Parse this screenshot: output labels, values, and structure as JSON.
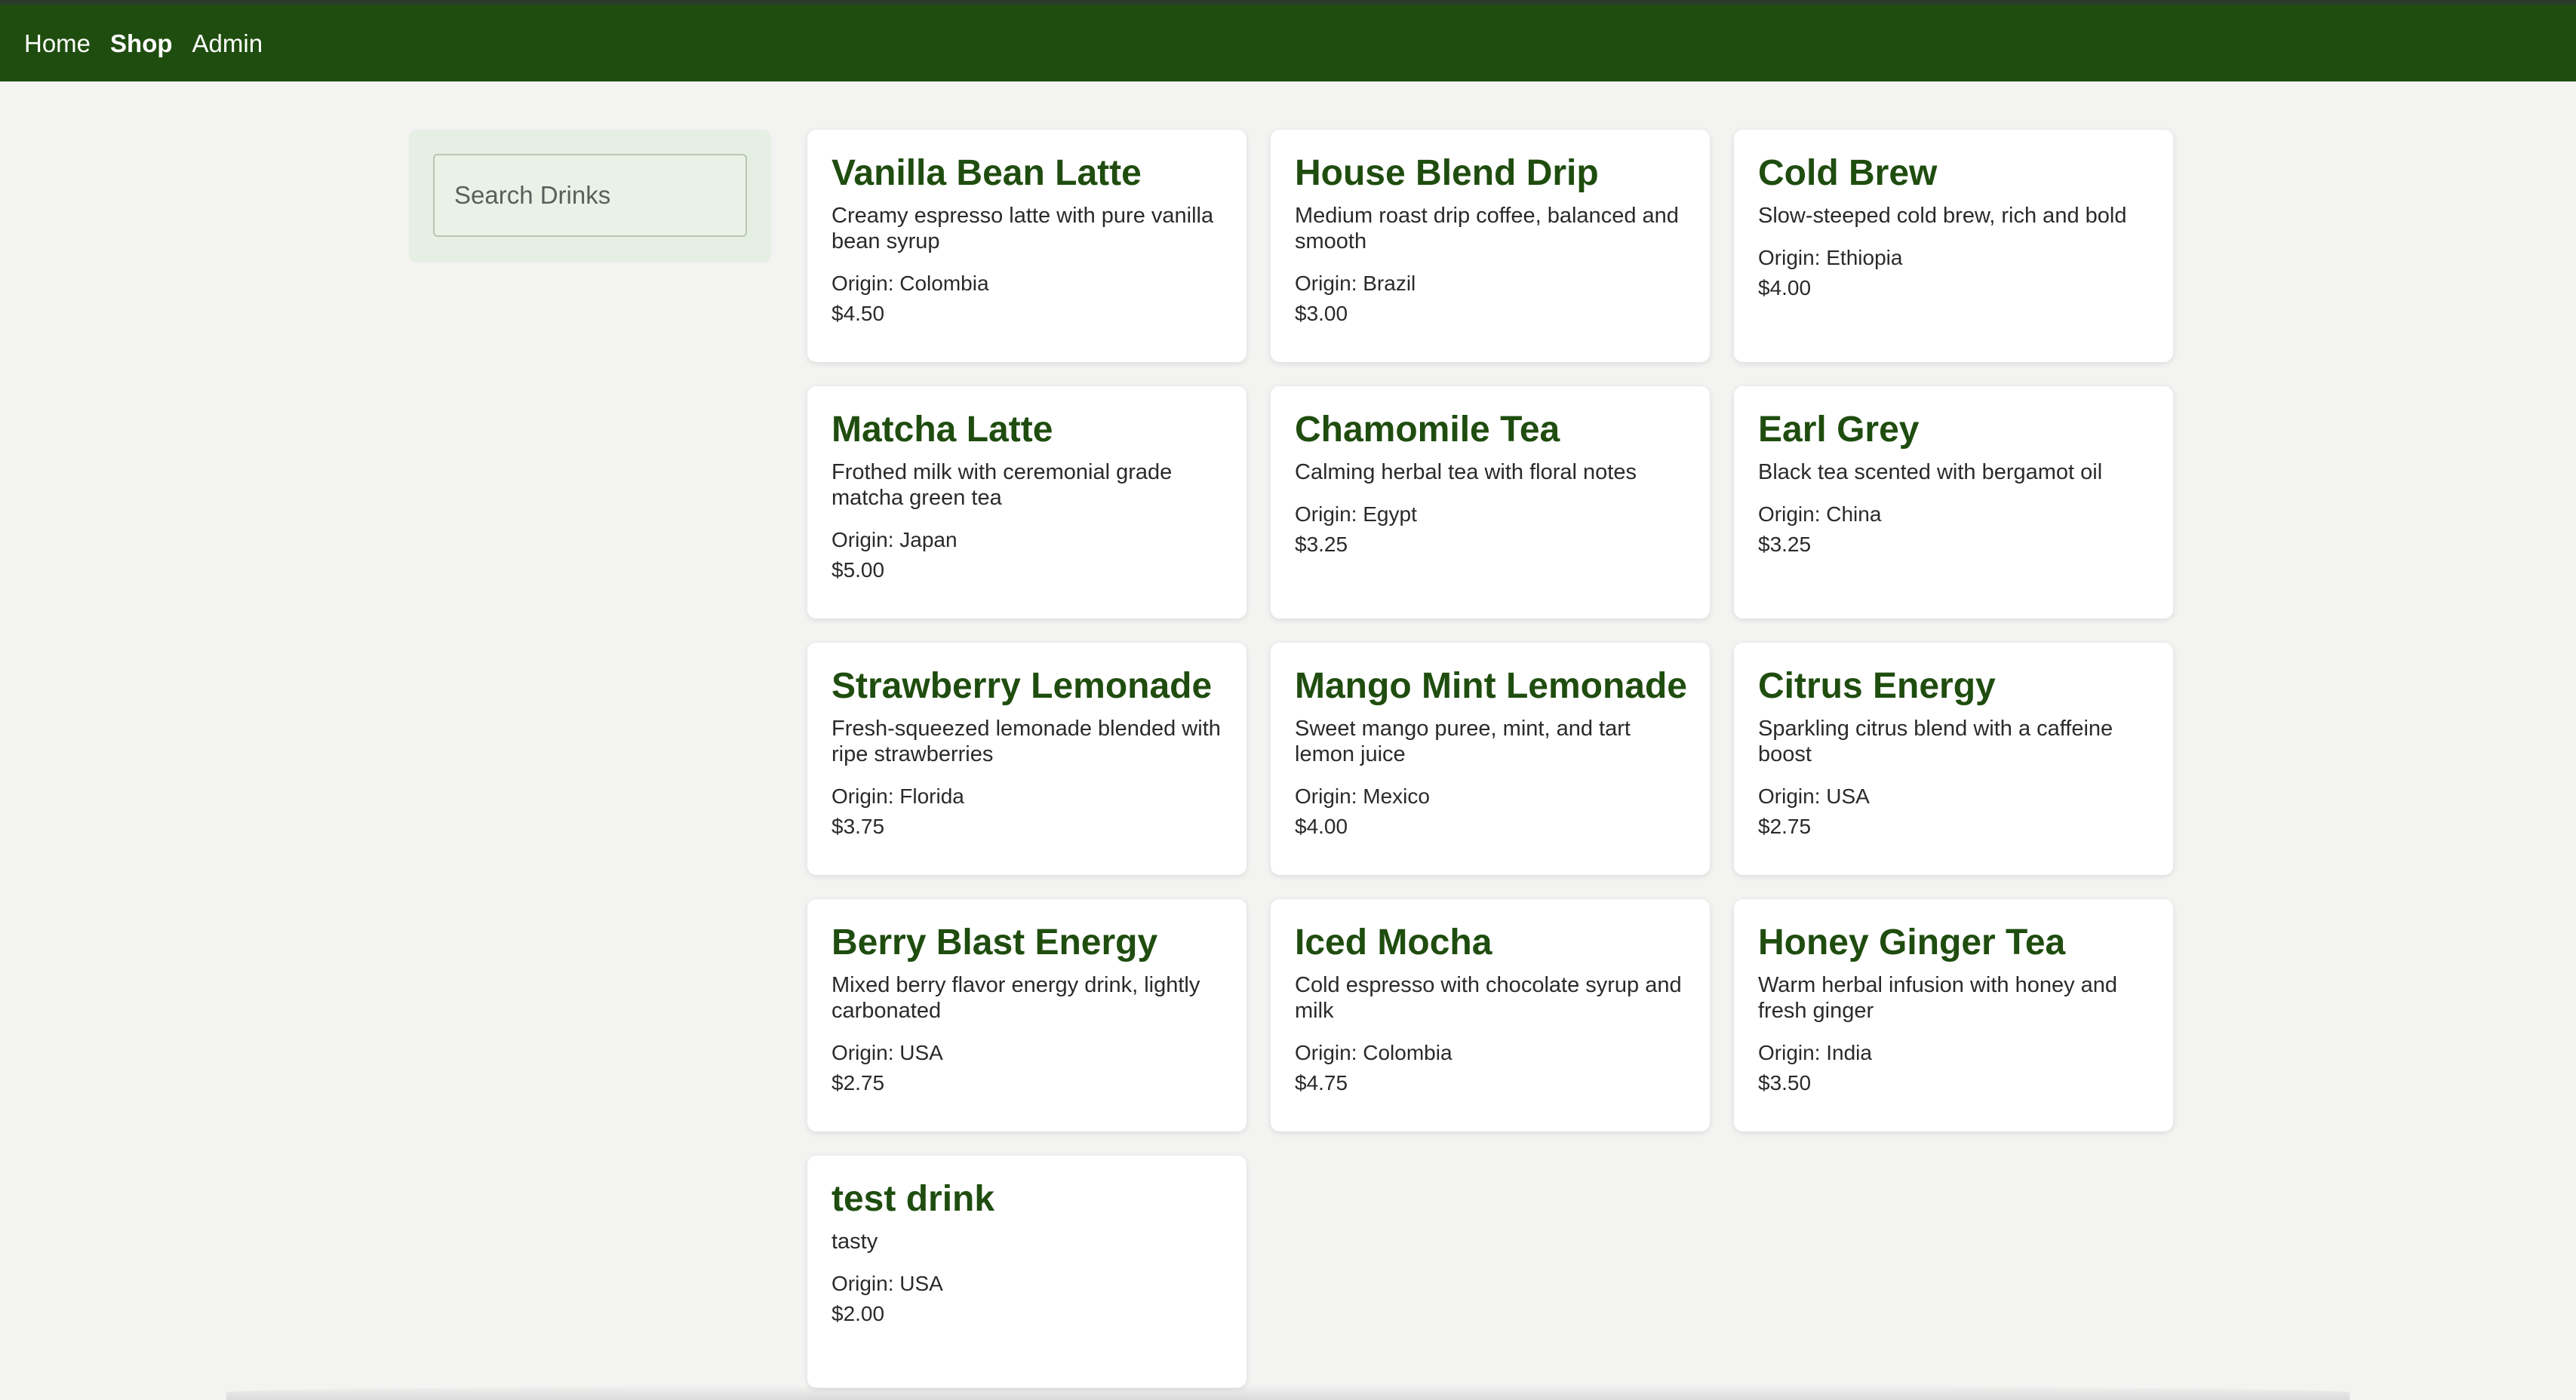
{
  "nav": {
    "items": [
      {
        "label": "Home",
        "active": false
      },
      {
        "label": "Shop",
        "active": true
      },
      {
        "label": "Admin",
        "active": false
      }
    ]
  },
  "search": {
    "placeholder": "Search Drinks",
    "value": ""
  },
  "products": [
    {
      "name": "Vanilla Bean Latte",
      "description": "Creamy espresso latte with pure vanilla bean syrup",
      "origin": "Origin: Colombia",
      "price": "$4.50"
    },
    {
      "name": "House Blend Drip",
      "description": "Medium roast drip coffee, balanced and smooth",
      "origin": "Origin: Brazil",
      "price": "$3.00"
    },
    {
      "name": "Cold Brew",
      "description": "Slow-steeped cold brew, rich and bold",
      "origin": "Origin: Ethiopia",
      "price": "$4.00"
    },
    {
      "name": "Matcha Latte",
      "description": "Frothed milk with ceremonial grade matcha green tea",
      "origin": "Origin: Japan",
      "price": "$5.00"
    },
    {
      "name": "Chamomile Tea",
      "description": "Calming herbal tea with floral notes",
      "origin": "Origin: Egypt",
      "price": "$3.25"
    },
    {
      "name": "Earl Grey",
      "description": "Black tea scented with bergamot oil",
      "origin": "Origin: China",
      "price": "$3.25"
    },
    {
      "name": "Strawberry Lemonade",
      "description": "Fresh-squeezed lemonade blended with ripe strawberries",
      "origin": "Origin: Florida",
      "price": "$3.75"
    },
    {
      "name": "Mango Mint Lemonade",
      "description": "Sweet mango puree, mint, and tart lemon juice",
      "origin": "Origin: Mexico",
      "price": "$4.00"
    },
    {
      "name": "Citrus Energy",
      "description": "Sparkling citrus blend with a caffeine boost",
      "origin": "Origin: USA",
      "price": "$2.75"
    },
    {
      "name": "Berry Blast Energy",
      "description": "Mixed berry flavor energy drink, lightly carbonated",
      "origin": "Origin: USA",
      "price": "$2.75"
    },
    {
      "name": "Iced Mocha",
      "description": "Cold espresso with chocolate syrup and milk",
      "origin": "Origin: Colombia",
      "price": "$4.75"
    },
    {
      "name": "Honey Ginger Tea",
      "description": "Warm herbal infusion with honey and fresh ginger",
      "origin": "Origin: India",
      "price": "$3.50"
    },
    {
      "name": "test drink",
      "description": "tasty",
      "origin": "Origin: USA",
      "price": "$2.00"
    }
  ],
  "colors": {
    "navbar": "#1f4d0f",
    "title": "#1f4d0f",
    "background": "#f3f3f2",
    "search_panel": "#e6efe4"
  }
}
